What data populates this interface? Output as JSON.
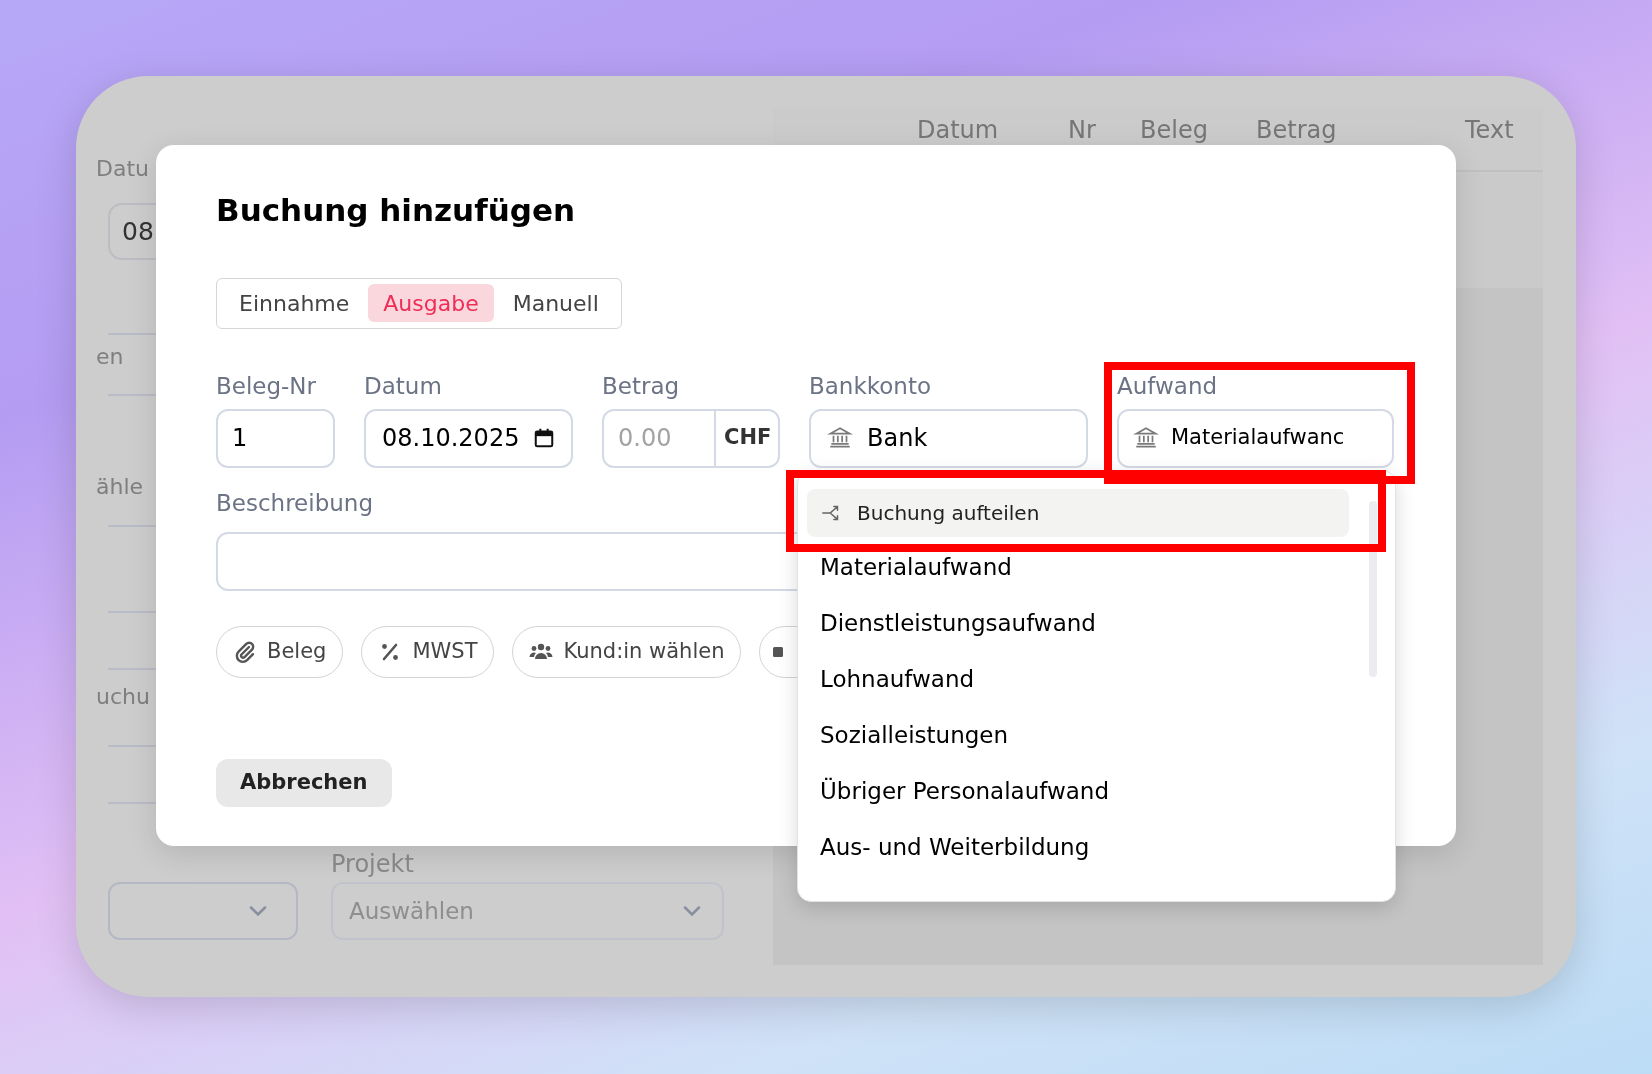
{
  "background": {
    "date_label": "Datu",
    "date_value": "08",
    "row_labels": [
      "en",
      "ähle",
      "uchu"
    ],
    "table_columns": [
      "Datum",
      "Nr",
      "Beleg",
      "Betrag",
      "Text"
    ],
    "project_label": "Projekt",
    "project_placeholder": "Auswählen"
  },
  "dialog": {
    "title": "Buchung hinzufügen",
    "tabs": [
      {
        "label": "Einnahme",
        "selected": false
      },
      {
        "label": "Ausgabe",
        "selected": true
      },
      {
        "label": "Manuell",
        "selected": false
      }
    ],
    "beleg_nr": {
      "label": "Beleg-Nr",
      "value": "1"
    },
    "datum": {
      "label": "Datum",
      "value": "08.10.2025"
    },
    "betrag": {
      "label": "Betrag",
      "placeholder": "0.00",
      "currency": "CHF"
    },
    "bankkonto": {
      "label": "Bankkonto",
      "value": "Bank"
    },
    "aufwand": {
      "label": "Aufwand",
      "value": "Materialaufwanc"
    },
    "beschreibung": {
      "label": "Beschreibung"
    },
    "chips": [
      {
        "kind": "attachment",
        "label": "Beleg"
      },
      {
        "kind": "percent",
        "label": "MWST"
      },
      {
        "kind": "people",
        "label": "Kund:in wählen"
      },
      {
        "kind": "partial"
      }
    ],
    "cancel_button": "Abbrechen"
  },
  "dropdown": {
    "split_action": {
      "label": "Buchung aufteilen",
      "highlighted": true
    },
    "items": [
      "Materialaufwand",
      "Dienstleistungsaufwand",
      "Lohnaufwand",
      "Sozialleistungen",
      "Übriger Personalaufwand",
      "Aus- und Weiterbildung"
    ]
  }
}
